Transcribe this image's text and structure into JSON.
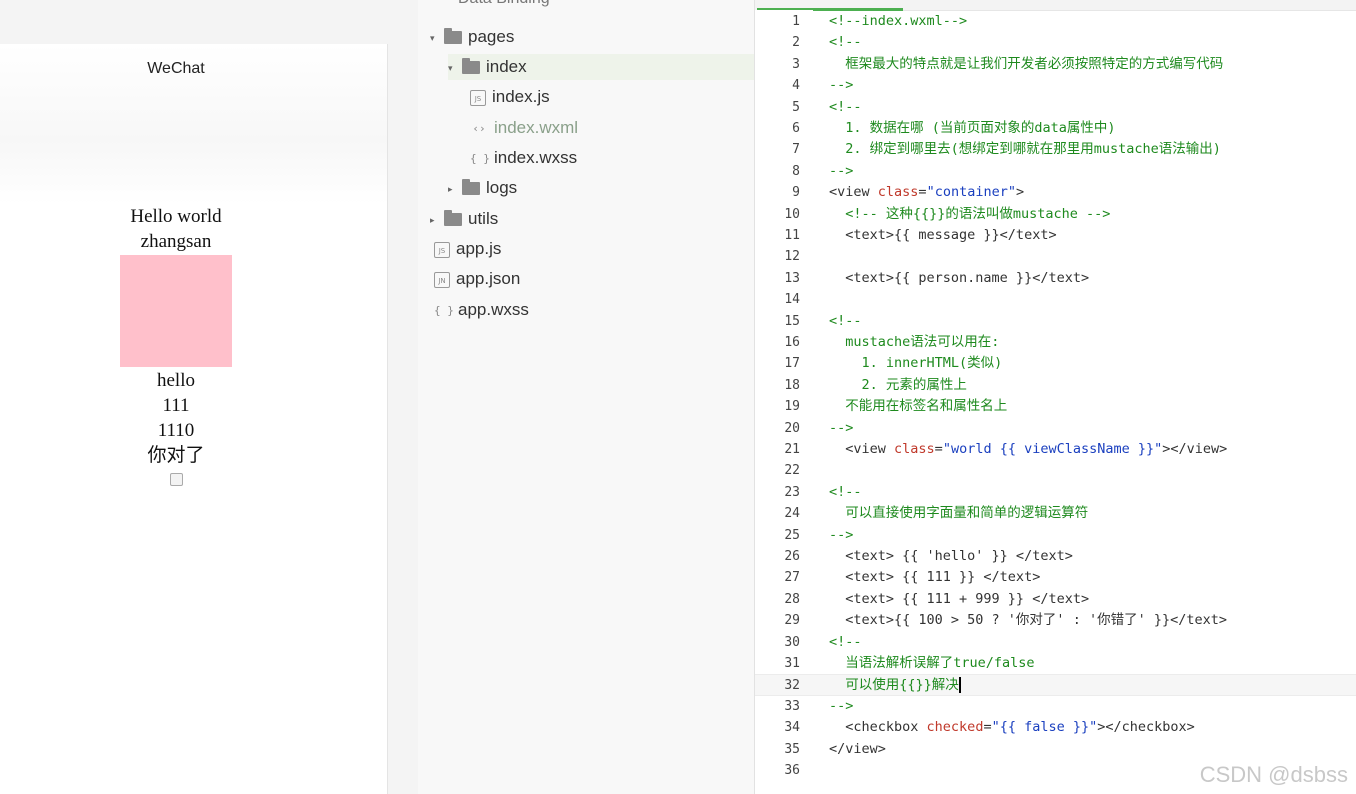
{
  "simulator": {
    "title": "WeChat",
    "lines": [
      "Hello world",
      "zhangsan"
    ],
    "box_color": "#ffc0cb",
    "lines_after": [
      "hello",
      "111",
      "1110",
      "你对了"
    ],
    "checkbox_checked": false
  },
  "explorer": {
    "header": "Data Binding",
    "items": [
      {
        "label": "pages",
        "kind": "folder",
        "arrow": "▾",
        "indent": 0
      },
      {
        "label": "index",
        "kind": "folder",
        "arrow": "▾",
        "indent": 1
      },
      {
        "label": "index.js",
        "kind": "js",
        "icon_text": "JS",
        "indent": 2
      },
      {
        "label": "index.wxml",
        "kind": "wxml",
        "icon_text": "‹›",
        "indent": 2
      },
      {
        "label": "index.wxss",
        "kind": "wxss",
        "icon_text": "{ }",
        "indent": 2
      },
      {
        "label": "logs",
        "kind": "folder",
        "arrow": "▸",
        "indent": 1
      },
      {
        "label": "utils",
        "kind": "folder",
        "arrow": "▸",
        "indent": 0
      },
      {
        "label": "app.js",
        "kind": "js",
        "icon_text": "JS",
        "indent": 0
      },
      {
        "label": "app.json",
        "kind": "json",
        "icon_text": "JN",
        "indent": 0
      },
      {
        "label": "app.wxss",
        "kind": "wxss",
        "icon_text": "{ }",
        "indent": 0
      }
    ]
  },
  "editor": {
    "lines": [
      [
        [
          "c",
          "<!--index.wxml-->"
        ]
      ],
      [
        [
          "c",
          "<!--"
        ]
      ],
      [
        [
          "c",
          "  框架最大的特点就是让我们开发者必须按照特定的方式编写代码"
        ]
      ],
      [
        [
          "c",
          "-->"
        ]
      ],
      [
        [
          "c",
          "<!--"
        ]
      ],
      [
        [
          "c",
          "  1. 数据在哪 (当前页面对象的data属性中)"
        ]
      ],
      [
        [
          "c",
          "  2. 绑定到哪里去(想绑定到哪就在那里用mustache语法输出)"
        ]
      ],
      [
        [
          "c",
          "-->"
        ]
      ],
      [
        [
          "t",
          "<view "
        ],
        [
          "a",
          "class"
        ],
        [
          "t",
          "="
        ],
        [
          "s",
          "\"container\""
        ],
        [
          "t",
          ">"
        ]
      ],
      [
        [
          "c",
          "  <!-- 这种{{}}的语法叫做mustache -->"
        ]
      ],
      [
        [
          "t",
          "  <text>{{ message }}</text>"
        ]
      ],
      [
        [
          "t",
          ""
        ]
      ],
      [
        [
          "t",
          "  <text>{{ person.name }}</text>"
        ]
      ],
      [
        [
          "t",
          ""
        ]
      ],
      [
        [
          "c",
          "<!--"
        ]
      ],
      [
        [
          "c",
          "  mustache语法可以用在:"
        ]
      ],
      [
        [
          "c",
          "    1. innerHTML(类似)"
        ]
      ],
      [
        [
          "c",
          "    2. 元素的属性上"
        ]
      ],
      [
        [
          "c",
          "  不能用在标签名和属性名上"
        ]
      ],
      [
        [
          "c",
          "-->"
        ]
      ],
      [
        [
          "t",
          "  <view "
        ],
        [
          "a",
          "class"
        ],
        [
          "t",
          "="
        ],
        [
          "s",
          "\"world {{ viewClassName }}\""
        ],
        [
          "t",
          "></view>"
        ]
      ],
      [
        [
          "t",
          ""
        ]
      ],
      [
        [
          "c",
          "<!--"
        ]
      ],
      [
        [
          "c",
          "  可以直接使用字面量和简单的逻辑运算符"
        ]
      ],
      [
        [
          "c",
          "-->"
        ]
      ],
      [
        [
          "t",
          "  <text> {{ 'hello' }} </text>"
        ]
      ],
      [
        [
          "t",
          "  <text> {{ 111 }} </text>"
        ]
      ],
      [
        [
          "t",
          "  <text> {{ 111 + 999 }} </text>"
        ]
      ],
      [
        [
          "t",
          "  <text>{{ 100 > 50 ? '你对了' : '你错了' }}</text>"
        ]
      ],
      [
        [
          "c",
          "<!--"
        ]
      ],
      [
        [
          "c",
          "  当语法解析误解了true/false"
        ]
      ],
      [
        [
          "c",
          "  可以使用{{}}解决"
        ]
      ],
      [
        [
          "c",
          "-->"
        ]
      ],
      [
        [
          "t",
          "  <checkbox "
        ],
        [
          "a",
          "checked"
        ],
        [
          "t",
          "="
        ],
        [
          "s",
          "\"{{ false }}\""
        ],
        [
          "t",
          "></checkbox>"
        ]
      ],
      [
        [
          "t",
          "</view>"
        ]
      ],
      [
        [
          "t",
          ""
        ]
      ]
    ],
    "current_line": 32
  },
  "watermark": "CSDN @dsbss"
}
